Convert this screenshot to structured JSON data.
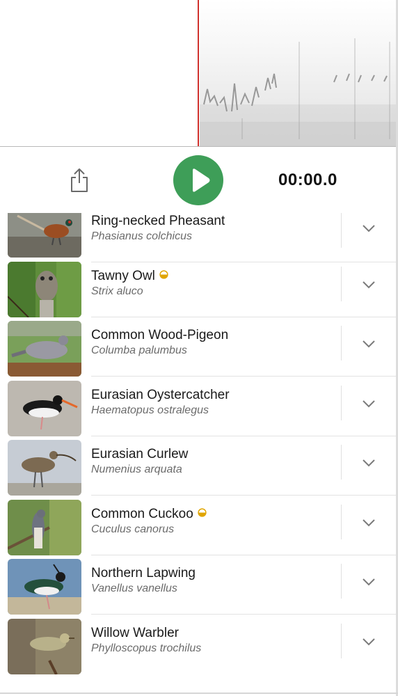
{
  "player": {
    "timer": "00:00.0",
    "colors": {
      "play": "#3e9e58",
      "playhead": "#d0312d"
    }
  },
  "birds": [
    {
      "common": "Ring-necked Pheasant",
      "scientific": "Phasianus colchicus",
      "badge": false,
      "icon": "pheasant-photo"
    },
    {
      "common": "Tawny Owl",
      "scientific": "Strix aluco",
      "badge": true,
      "icon": "tawny-owl-photo"
    },
    {
      "common": "Common Wood-Pigeon",
      "scientific": "Columba palumbus",
      "badge": false,
      "icon": "wood-pigeon-photo"
    },
    {
      "common": "Eurasian Oystercatcher",
      "scientific": "Haematopus ostralegus",
      "badge": false,
      "icon": "oystercatcher-photo"
    },
    {
      "common": "Eurasian Curlew",
      "scientific": "Numenius arquata",
      "badge": false,
      "icon": "curlew-photo"
    },
    {
      "common": "Common Cuckoo",
      "scientific": "Cuculus canorus",
      "badge": true,
      "icon": "cuckoo-photo"
    },
    {
      "common": "Northern Lapwing",
      "scientific": "Vanellus vanellus",
      "badge": false,
      "icon": "lapwing-photo"
    },
    {
      "common": "Willow Warbler",
      "scientific": "Phylloscopus trochilus",
      "badge": false,
      "icon": "willow-warbler-photo"
    }
  ],
  "badge_color": "#e0a500"
}
